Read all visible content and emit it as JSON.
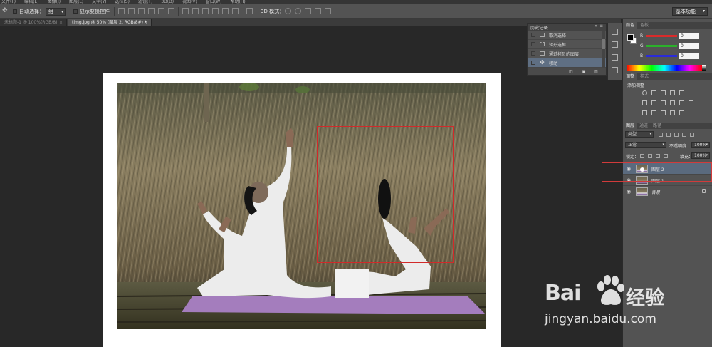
{
  "menubar": {
    "items": [
      "文件(F)",
      "编辑(E)",
      "图像(I)",
      "图层(L)",
      "文字(Y)",
      "选择(S)",
      "滤镜(T)",
      "3D(D)",
      "视图(V)",
      "窗口(W)",
      "帮助(H)"
    ]
  },
  "options_bar": {
    "auto_select_label": "自动选择：",
    "auto_select_value": "组",
    "show_transform_label": "显示变换控件",
    "mode_3d_label": "3D 模式：",
    "workspace": "基本功能"
  },
  "doc_tabs": [
    {
      "label": "未标题-1 @ 100%(RGB/8)",
      "close": "×"
    },
    {
      "label": "timg.jpg @ 50% (图层 2, RGB/8#) *",
      "close": "×"
    }
  ],
  "history_panel": {
    "title": "历史记录",
    "collapse_glyph": "»",
    "menu_glyph": "≡",
    "items": [
      {
        "label": "取消选择",
        "icon": "document-icon"
      },
      {
        "label": "矩形选框",
        "icon": "marquee-icon"
      },
      {
        "label": "通过拷贝的图层",
        "icon": "document-icon"
      },
      {
        "label": "移动",
        "icon": "move-icon",
        "active": true
      }
    ],
    "footer_icons": [
      "new-snapshot-icon",
      "camera-icon",
      "trash-icon"
    ]
  },
  "color_panel": {
    "tabs": [
      "颜色",
      "色板"
    ],
    "channels": [
      {
        "label": "R",
        "value": "0",
        "color": "#d92b2b"
      },
      {
        "label": "G",
        "value": "0",
        "color": "#2bb02b"
      },
      {
        "label": "B",
        "value": "0",
        "color": "#2b2bd9"
      }
    ]
  },
  "adjustments_panel": {
    "tabs": [
      "调整",
      "样式"
    ],
    "title": "添加调整"
  },
  "layers_panel": {
    "tabs": [
      "图层",
      "通道",
      "路径"
    ],
    "filter_label": "类型",
    "blend_mode": "正常",
    "opacity_label": "不透明度：",
    "opacity_value": "100%",
    "lock_label": "锁定：",
    "fill_label": "填充：",
    "fill_value": "100%",
    "layers": [
      {
        "name": "图层 2",
        "active": true
      },
      {
        "name": "图层 1",
        "active": false
      },
      {
        "name": "背景",
        "active": false,
        "locked": true
      }
    ]
  },
  "watermark": {
    "brand_left": "Bai",
    "brand_right": "经验",
    "url": "jingyan.baidu.com"
  }
}
